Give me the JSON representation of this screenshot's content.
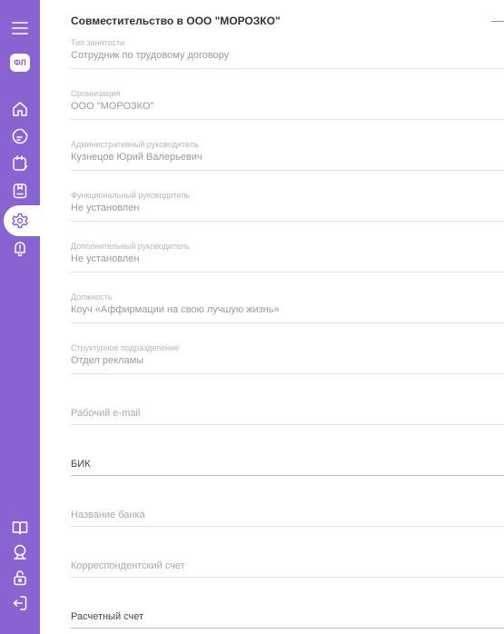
{
  "sidebar": {
    "badge": "ФЛ",
    "icons": [
      "menu-icon",
      "home-icon",
      "document-icon",
      "calendar-edit-icon",
      "clipboard-icon",
      "gear-icon",
      "bell-icon",
      "book-icon",
      "presentation-icon",
      "unlock-icon",
      "logout-icon"
    ],
    "active": "gear-icon",
    "accent": "#8a63d2"
  },
  "section": {
    "title": "Совместительство в ООО \"МОРОЗКО\"",
    "collapse_symbol": "—"
  },
  "fields": [
    {
      "label": "Тип занятости",
      "value": "Сотрудник по трудовому договору"
    },
    {
      "label": "Организация",
      "value": "ООО \"МОРОЗКО\""
    },
    {
      "label": "Административный руководитель",
      "value": "Кузнецов Юрий Валерьевич"
    },
    {
      "label": "Функциональный руководитель",
      "value": "Не установлен"
    },
    {
      "label": "Дополнительный руководитель",
      "value": "Не установлен"
    },
    {
      "label": "Должность",
      "value": "Коуч «Аффирмации на свою лучшую жизнь»"
    },
    {
      "label": "Структурное подразделение",
      "value": "Отдел рекламы"
    }
  ],
  "inputs": [
    {
      "placeholder": "Рабочий e-mail"
    },
    {
      "placeholder": "БИК"
    },
    {
      "placeholder": "Название банка"
    },
    {
      "placeholder": "Корреспондентский счет"
    },
    {
      "placeholder": "Расчетный счет"
    }
  ]
}
